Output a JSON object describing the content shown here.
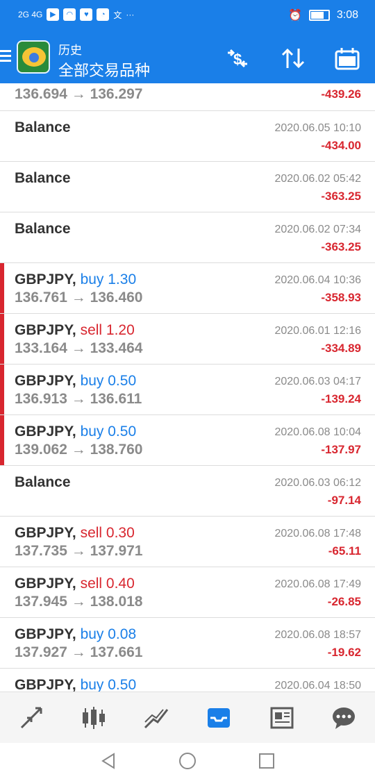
{
  "status_bar": {
    "left_text": "2G 4G",
    "time": "3:08",
    "lang_icon": "文",
    "dots": "···"
  },
  "app_bar": {
    "title_small": "历史",
    "title_big": "全部交易品种"
  },
  "rows": [
    {
      "type": "trade",
      "partial": true,
      "prices": "136.694 → 136.297",
      "profit": "-439.26"
    },
    {
      "type": "balance",
      "label": "Balance",
      "time": "2020.06.05 10:10",
      "profit": "-434.00"
    },
    {
      "type": "balance",
      "label": "Balance",
      "time": "2020.06.02 05:42",
      "profit": "-363.25"
    },
    {
      "type": "balance",
      "label": "Balance",
      "time": "2020.06.02 07:34",
      "profit": "-363.25"
    },
    {
      "type": "trade",
      "symbol": "GBPJPY,",
      "side": "buy 1.30",
      "side_type": "buy",
      "prices": "136.761 → 136.460",
      "time": "2020.06.04 10:36",
      "profit": "-358.93"
    },
    {
      "type": "trade",
      "symbol": "GBPJPY,",
      "side": "sell 1.20",
      "side_type": "sell",
      "prices": "133.164 → 133.464",
      "time": "2020.06.01 12:16",
      "profit": "-334.89"
    },
    {
      "type": "trade",
      "symbol": "GBPJPY,",
      "side": "buy 0.50",
      "side_type": "buy",
      "prices": "136.913 → 136.611",
      "time": "2020.06.03 04:17",
      "profit": "-139.24"
    },
    {
      "type": "trade",
      "symbol": "GBPJPY,",
      "side": "buy 0.50",
      "side_type": "buy",
      "prices": "139.062 → 138.760",
      "time": "2020.06.08 10:04",
      "profit": "-137.97"
    },
    {
      "type": "balance",
      "label": "Balance",
      "time": "2020.06.03 06:12",
      "profit": "-97.14"
    },
    {
      "type": "trade",
      "symbol": "GBPJPY,",
      "side": "sell 0.30",
      "side_type": "sell",
      "prices": "137.735 → 137.971",
      "time": "2020.06.08 17:48",
      "profit": "-65.11"
    },
    {
      "type": "trade",
      "symbol": "GBPJPY,",
      "side": "sell 0.40",
      "side_type": "sell",
      "prices": "137.945 → 138.018",
      "time": "2020.06.08 17:49",
      "profit": "-26.85"
    },
    {
      "type": "trade",
      "symbol": "GBPJPY,",
      "side": "buy 0.08",
      "side_type": "buy",
      "prices": "137.927 → 137.661",
      "time": "2020.06.08 18:57",
      "profit": "-19.62"
    },
    {
      "type": "trade",
      "symbol": "GBPJPY,",
      "side": "buy 0.50",
      "side_type": "buy",
      "time": "2020.06.04 18:50"
    }
  ],
  "bottom_nav": [
    {
      "name": "quotes",
      "icon": "arrows-icon"
    },
    {
      "name": "chart",
      "icon": "candles-icon"
    },
    {
      "name": "trade",
      "icon": "trend-icon"
    },
    {
      "name": "history",
      "icon": "inbox-icon",
      "active": true
    },
    {
      "name": "news",
      "icon": "news-icon"
    },
    {
      "name": "chat",
      "icon": "chat-icon"
    }
  ],
  "colors": {
    "accent": "#1a7fe8",
    "loss": "#d8262f",
    "text": "#333333",
    "muted": "#8a8a8a"
  }
}
